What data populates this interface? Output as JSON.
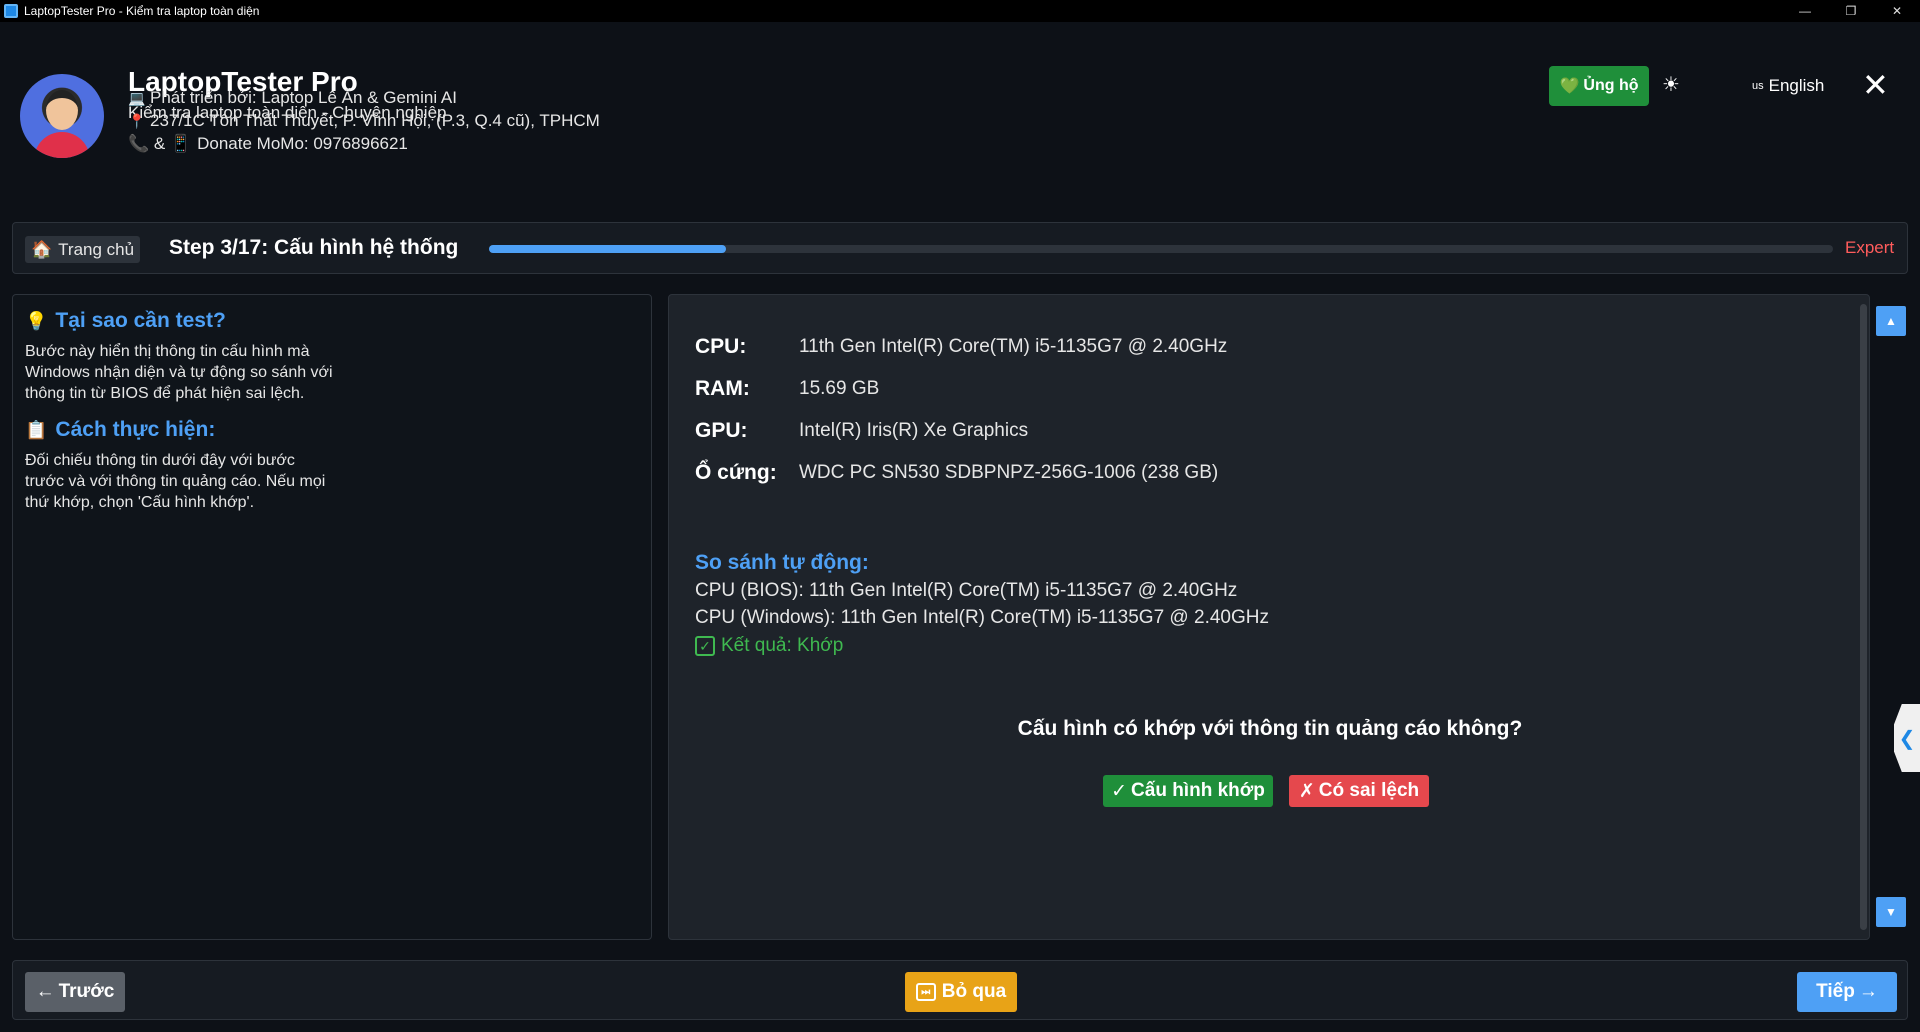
{
  "window": {
    "title": "LaptopTester Pro - Kiểm tra laptop toàn diện",
    "minimize_glyph": "—",
    "restore_glyph": "❐",
    "close_glyph": "✕"
  },
  "header": {
    "app_name": "LaptopTester Pro",
    "subtitle": "Kiểm tra laptop toàn diện - Chuyên nghiệp",
    "developer_icon": "💻",
    "developer": "Phát triển bởi: Laptop Lê Ẩn & Gemini AI",
    "address_icon": "📍",
    "address": "237/1C Tôn Thất Thuyết, P. Vĩnh Hội, (P.3, Q.4 cũ), TPHCM",
    "contact_icons": "📞 & 📱",
    "contact": "Donate MoMo: 0976896621",
    "support_icon": "💚",
    "support_label": "Ủng hộ",
    "theme_icon": "☀",
    "language_flag": "us",
    "language": "English",
    "close_glyph": "✕"
  },
  "stepbar": {
    "home_icon": "🏠",
    "home_label": "Trang chủ",
    "step_title": "Step 3/17: Cấu hình hệ thống",
    "progress_fraction": 0.1765,
    "level": "Expert"
  },
  "guide": {
    "why_icon": "💡",
    "why_title": "Tại sao cần test?",
    "why_text": "Bước này hiển thị thông tin cấu hình mà Windows nhận diện và tự động so sánh với thông tin từ BIOS để phát hiện sai lệch.",
    "how_icon": "📋",
    "how_title": "Cách thực hiện:",
    "how_text": "Đối chiếu thông tin dưới đây với bước trước và với thông tin quảng cáo. Nếu mọi thứ khớp, chọn 'Cấu hình khớp'."
  },
  "specs": [
    {
      "label": "CPU:",
      "value": "11th Gen Intel(R) Core(TM) i5-1135G7 @ 2.40GHz"
    },
    {
      "label": "RAM:",
      "value": "15.69 GB"
    },
    {
      "label": "GPU:",
      "value": "Intel(R) Iris(R) Xe Graphics"
    },
    {
      "label": "Ổ cứng:",
      "value": "WDC PC SN530 SDBPNPZ-256G-1006 (238 GB)"
    }
  ],
  "comparison": {
    "title": "So sánh tự động:",
    "bios_line": "CPU (BIOS): 11th Gen Intel(R) Core(TM) i5-1135G7 @ 2.40GHz",
    "windows_line": "CPU (Windows): 11th Gen Intel(R) Core(TM) i5-1135G7 @ 2.40GHz",
    "result_icon": "✓",
    "result": "Kết quả: Khớp"
  },
  "question": {
    "text": "Cấu hình có khớp với thông tin quảng cáo không?",
    "match_icon": "✓",
    "match_label": "Cấu hình khớp",
    "mismatch_icon": "✗",
    "mismatch_label": "Có sai lệch"
  },
  "scroll": {
    "up_glyph": "▲",
    "down_glyph": "▼",
    "side_tab_glyph": "❮"
  },
  "navigation": {
    "prev_icon": "←",
    "prev_label": "Trước",
    "skip_icon": "⏭",
    "skip_label": "Bỏ qua",
    "next_label": "Tiếp",
    "next_icon": "→"
  },
  "colors": {
    "background": "#0d1117",
    "accent": "#4ea0f5",
    "success": "#1f8f3a",
    "danger": "#e5484d",
    "warning": "#e8a317",
    "level": "#ff5c5c"
  }
}
